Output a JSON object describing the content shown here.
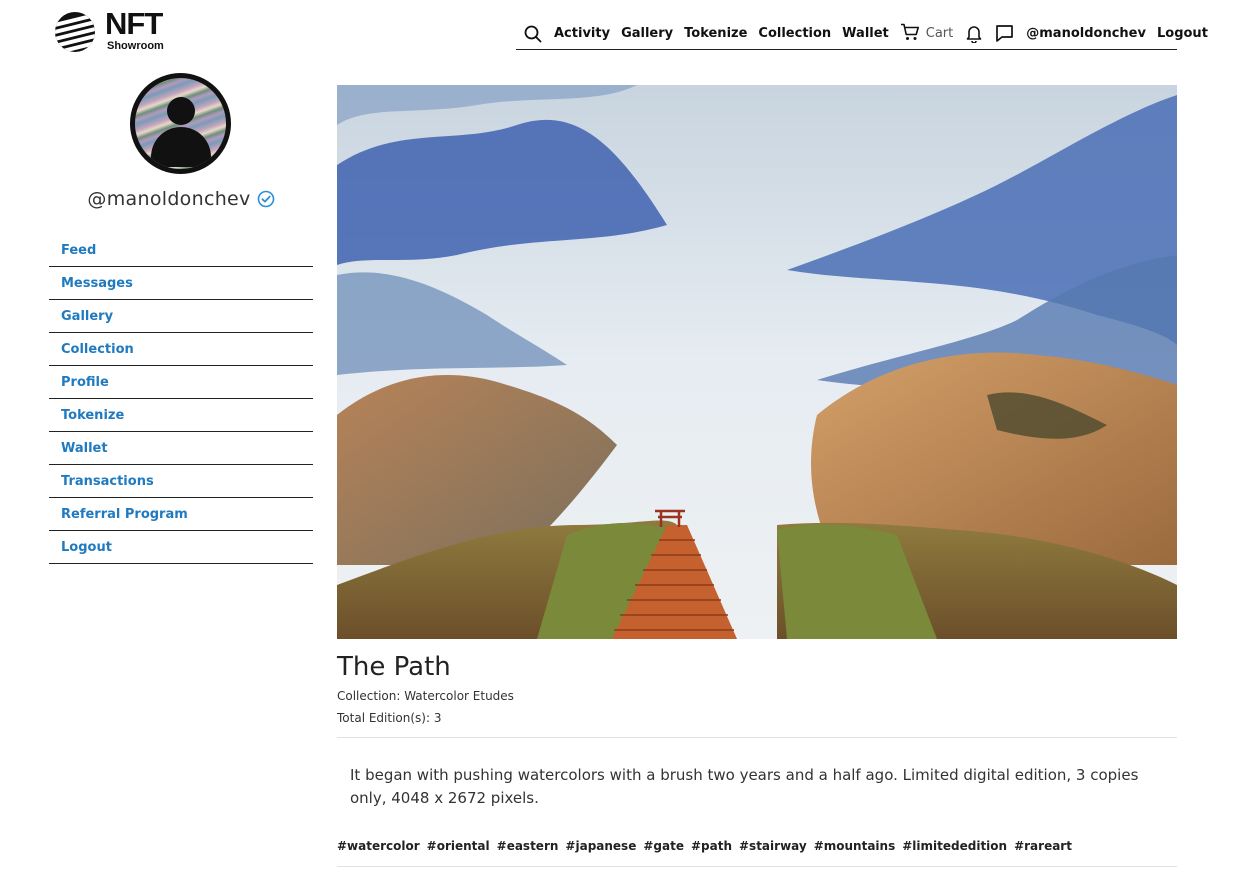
{
  "brand": {
    "name_big": "NFT",
    "name_small": "Showroom"
  },
  "topnav": {
    "activity": "Activity",
    "gallery": "Gallery",
    "tokenize": "Tokenize",
    "collection": "Collection",
    "wallet": "Wallet",
    "cart": "Cart",
    "user": "@manoldonchev",
    "logout": "Logout",
    "icons": [
      "search-icon",
      "cart-icon",
      "bell-icon",
      "message-icon"
    ]
  },
  "profile": {
    "username": "@manoldonchev",
    "verified": true
  },
  "sidebar": {
    "items": [
      {
        "label": "Feed"
      },
      {
        "label": "Messages"
      },
      {
        "label": "Gallery"
      },
      {
        "label": "Collection"
      },
      {
        "label": "Profile"
      },
      {
        "label": "Tokenize"
      },
      {
        "label": "Wallet"
      },
      {
        "label": "Transactions"
      },
      {
        "label": "Referral Program"
      },
      {
        "label": "Logout"
      }
    ]
  },
  "artwork": {
    "title": "The Path",
    "collection": "Collection: Watercolor Etudes",
    "editions": "Total Edition(s): 3",
    "description": "It began with pushing watercolors with a brush two years and a half ago. Limited digital edition, 3 copies only, 4048 x 2672 pixels.",
    "tags": [
      "#watercolor",
      "#oriental",
      "#eastern",
      "#japanese",
      "#gate",
      "#path",
      "#stairway",
      "#mountains",
      "#limitededition",
      "#rareart"
    ]
  },
  "colors": {
    "link": "#1f7ac0",
    "verified": "#2b8fd6",
    "divider": "#222222"
  }
}
